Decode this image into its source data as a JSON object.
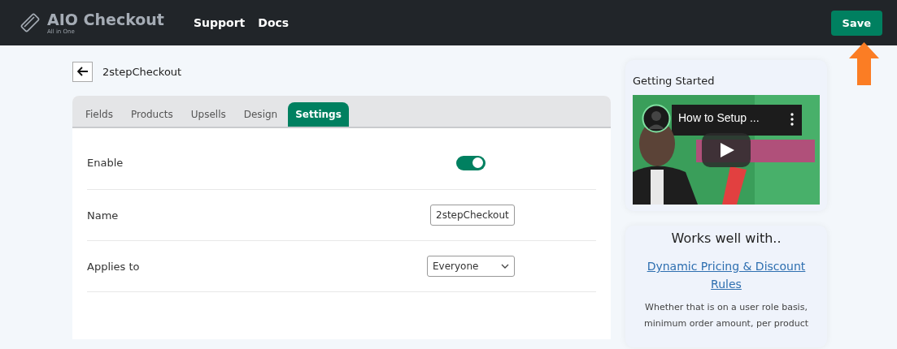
{
  "header": {
    "logo": {
      "title": "AIO Checkout",
      "subtitle": "All in One"
    },
    "nav": [
      "Support",
      "Docs"
    ],
    "save_button": "Save"
  },
  "page": {
    "title": "2stepCheckout"
  },
  "tabs": [
    {
      "label": "Fields",
      "selected": false
    },
    {
      "label": "Products",
      "selected": false
    },
    {
      "label": "Upsells",
      "selected": false
    },
    {
      "label": "Design",
      "selected": false
    },
    {
      "label": "Settings",
      "selected": true
    }
  ],
  "settings": [
    {
      "kind": "toggle",
      "label": "Enable",
      "on": true
    },
    {
      "kind": "text",
      "label": "Name",
      "value": "2stepCheckout"
    },
    {
      "kind": "select",
      "label": "Applies to",
      "value": "Everyone"
    }
  ],
  "getting_started": {
    "title": "Getting Started",
    "video": {
      "title": "How to Setup ..."
    }
  },
  "works_with": {
    "title": "Works well with..",
    "link": "Dynamic Pricing & Discount Rules",
    "description": "Whether that is on a user role basis, minimum order amount, per product"
  }
}
